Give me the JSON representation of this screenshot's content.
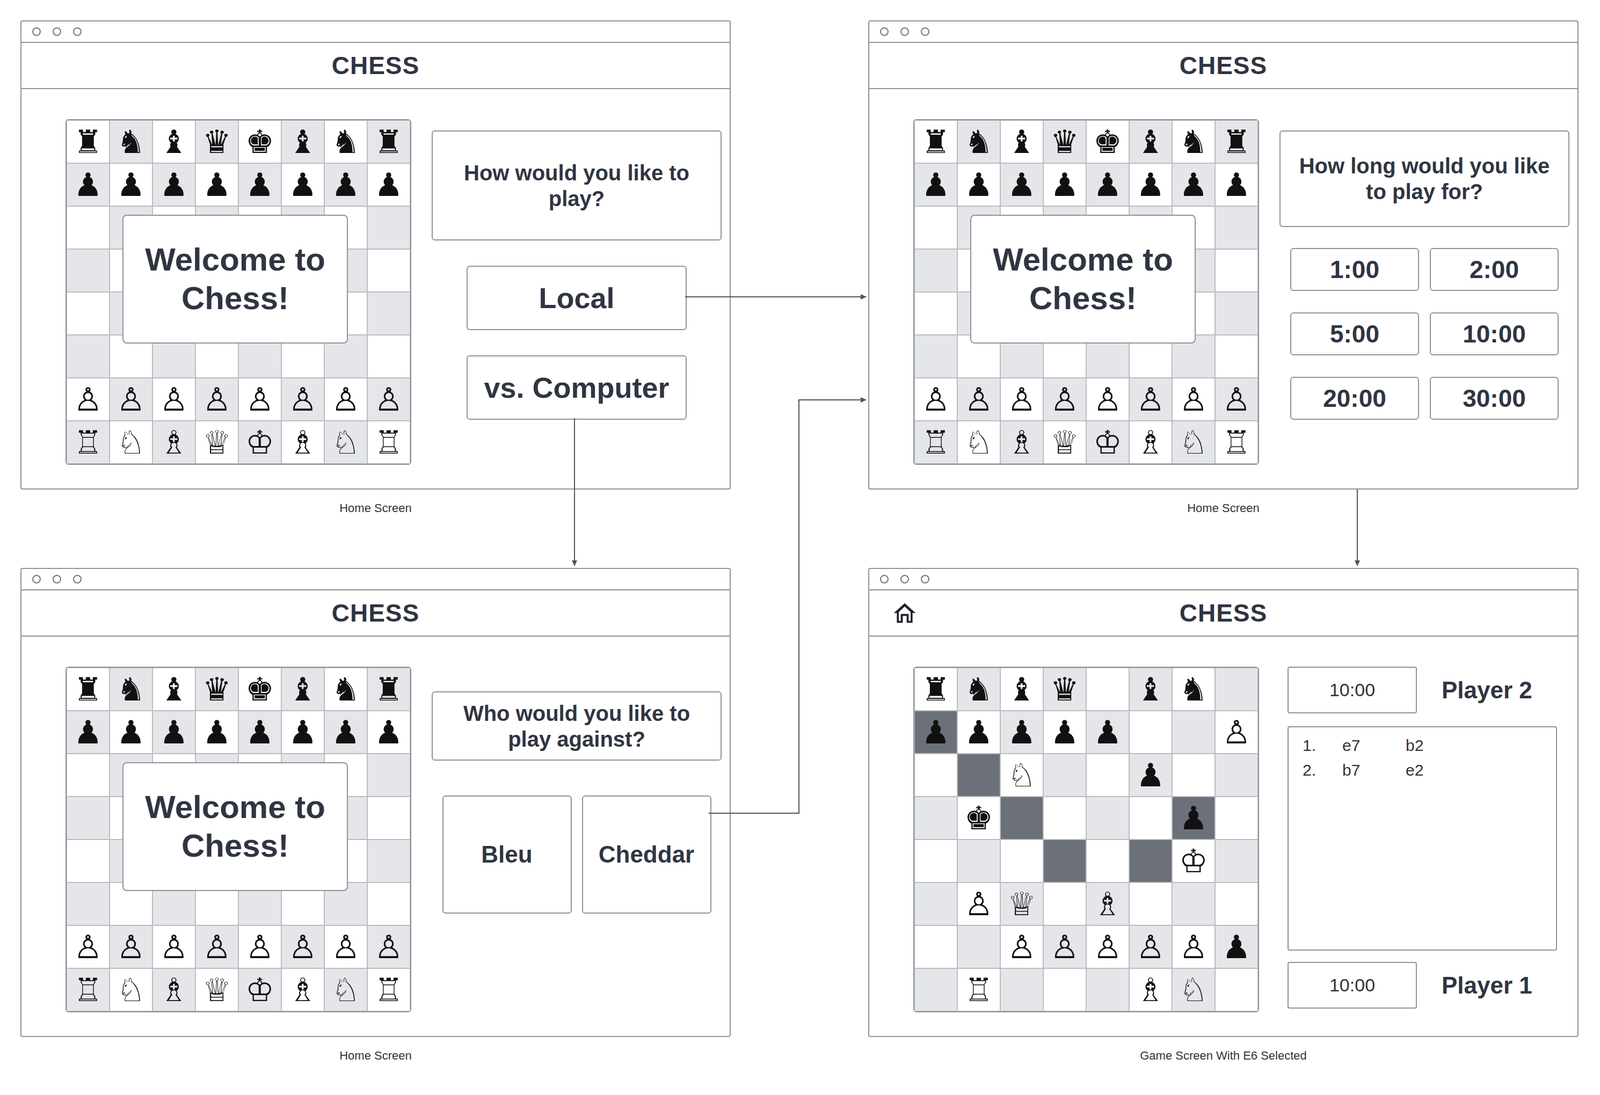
{
  "windows": [
    {
      "title": "CHESS",
      "caption": "Home Screen",
      "kind": "menu",
      "welcome": "Welcome to Chess!",
      "prompt": "How would you like to play?",
      "options": [
        {
          "label": "Local"
        },
        {
          "label": "vs. Computer"
        }
      ],
      "board": {
        "ranks": [
          "♜♞♝♛♚♝♞♜",
          "♟♟♟♟♟♟♟♟",
          "        ",
          "        ",
          "        ",
          "        ",
          "♙♙♙♙♙♙♙♙",
          "♖♘♗♕♔♗♘♖"
        ]
      }
    },
    {
      "title": "CHESS",
      "caption": "Home Screen",
      "kind": "time",
      "welcome": "Welcome to Chess!",
      "prompt": "How long would you like to play for?",
      "options": [
        {
          "label": "1:00"
        },
        {
          "label": "2:00"
        },
        {
          "label": "5:00"
        },
        {
          "label": "10:00"
        },
        {
          "label": "20:00"
        },
        {
          "label": "30:00"
        }
      ],
      "board": {
        "ranks": [
          "♜♞♝♛♚♝♞♜",
          "♟♟♟♟♟♟♟♟",
          "        ",
          "        ",
          "        ",
          "        ",
          "♙♙♙♙♙♙♙♙",
          "♖♘♗♕♔♗♘♖"
        ]
      }
    },
    {
      "title": "CHESS",
      "caption": "Home Screen",
      "kind": "opponent",
      "welcome": "Welcome to Chess!",
      "prompt": "Who would you like to play against?",
      "options": [
        {
          "label": "Bleu"
        },
        {
          "label": "Cheddar"
        }
      ],
      "board": {
        "ranks": [
          "♜♞♝♛♚♝♞♜",
          "♟♟♟♟♟♟♟♟",
          "        ",
          "        ",
          "        ",
          "        ",
          "♙♙♙♙♙♙♙♙",
          "♖♘♗♕♔♗♘♖"
        ]
      }
    },
    {
      "title": "CHESS",
      "caption": "Game Screen With E6 Selected",
      "kind": "game",
      "players": [
        {
          "name": "Player 2",
          "clock": "10:00"
        },
        {
          "name": "Player 1",
          "clock": "10:00"
        }
      ],
      "moves": [
        {
          "number": "1.",
          "white": "e7",
          "black": "b2"
        },
        {
          "number": "2.",
          "white": "b7",
          "black": "e2"
        }
      ],
      "board": {
        "ranks": [
          "♜♞♝♛ ♝♞ ",
          "♟♟♟♟♟  ♙",
          "  ♘  ♟  ",
          " ♚    ♟ ",
          "      ♔ ",
          " ♙♕ ♗   ",
          "  ♙♙♙♙♙♟",
          " ♖   ♗♘ "
        ],
        "marks": [
          "........",
          "d.......",
          ".d......",
          "..d...d.",
          "...d.d..",
          "........",
          "........",
          "........"
        ]
      }
    }
  ],
  "edges": [
    {
      "from": 0,
      "to": 1
    },
    {
      "from": 0,
      "to": 2
    },
    {
      "from": 2,
      "to": 1
    },
    {
      "from": 1,
      "to": 3
    }
  ]
}
